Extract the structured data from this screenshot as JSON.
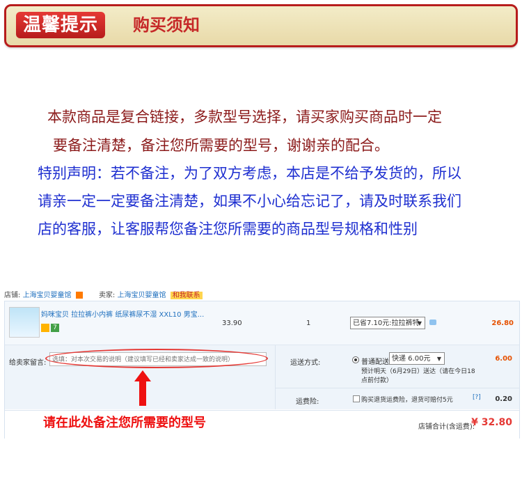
{
  "banner": {
    "left": "温馨提示",
    "right": "购买须知"
  },
  "notice": {
    "line1": "本款商品是复合链接，多款型号选择，请买家购买商品时一定",
    "line2": "要备注清楚，备注您所需要的型号，谢谢亲的配合。",
    "line3": "特别声明：若不备注，为了双方考虑，本店是不给予发货的，所以",
    "line4": "请亲一定一定要备注清楚，如果不小心给忘记了，请及时联系我们",
    "line5": "店的客服，让客服帮您备注您所需要的商品型号规格和性别"
  },
  "shop": {
    "label": "店铺:",
    "name": "上海宝贝婴童馆",
    "seller_label": "卖家:",
    "seller_name": "上海宝贝婴童馆",
    "contact": "和我联系"
  },
  "product": {
    "title": "妈咪宝贝 拉拉裤小内裤 纸尿裤尿不湿 XXL10 男宝...",
    "badge": "7",
    "price": "33.90",
    "qty": "1",
    "option": "已省7.10元:拉拉裤特",
    "subtotal": "26.80"
  },
  "message": {
    "label": "给卖家留言:",
    "placeholder": "选填：对本次交易的说明（建议填写已经和卖家达成一致的说明）"
  },
  "shipping": {
    "label": "运送方式:",
    "method": "普通配送",
    "select": "快递 6.00元",
    "fee": "6.00",
    "eta": "预计明天（6月29日）送达（请在今日18点前付款）"
  },
  "insurance": {
    "label": "运费险:",
    "text": "购买退货运费险，退货可赔付5元",
    "help": "[?]",
    "fee": "0.20"
  },
  "total": {
    "label": "店铺合计(含运费):",
    "value": "¥ 32.80"
  },
  "hint": "请在此处备注您所需要的型号",
  "colors": {
    "accent_red": "#e53935",
    "link_blue": "#1e6fbe",
    "orange": "#e65100"
  }
}
